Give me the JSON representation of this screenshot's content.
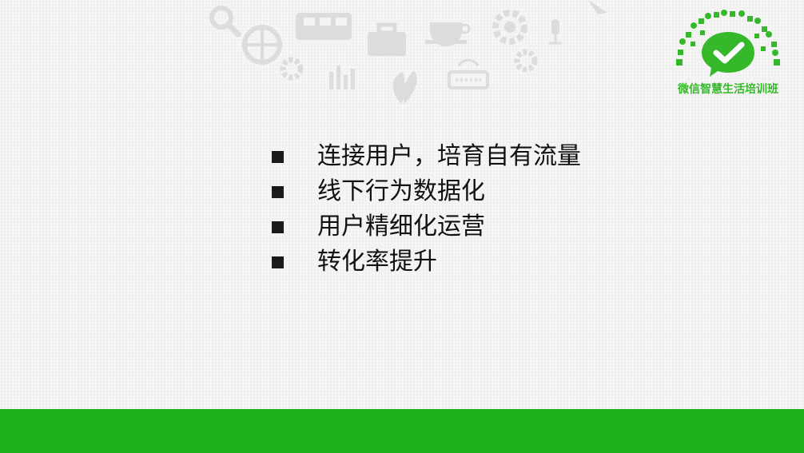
{
  "colors": {
    "accent_green": "#1bb21b",
    "logo_green": "#36b82b",
    "text": "#111111",
    "background": "#f4f4f4"
  },
  "logo": {
    "icon": "wechat-chat-check-icon",
    "text": "微信智慧生活培训班"
  },
  "watermark_icons": [
    "search-icon",
    "basketball-icon",
    "bus-icon",
    "briefcase-icon",
    "coffee-cup-icon",
    "gear-icon",
    "microphone-icon",
    "bar-chart-icon",
    "leaf-icon",
    "keyboard-icon"
  ],
  "bullets": [
    {
      "text": "连接用户，培育自有流量"
    },
    {
      "text": "线下行为数据化"
    },
    {
      "text": "用户精细化运营"
    },
    {
      "text": "转化率提升"
    }
  ]
}
